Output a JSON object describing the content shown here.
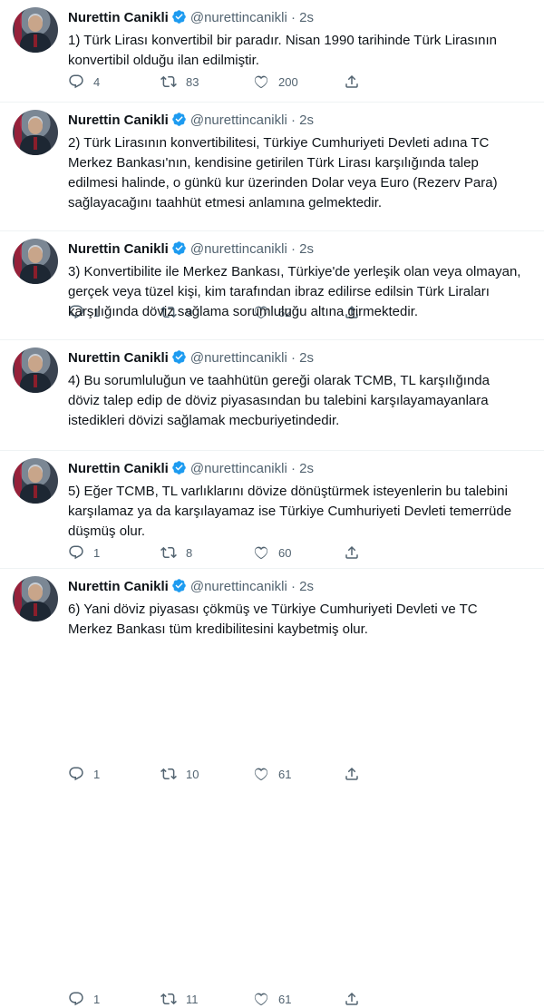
{
  "author": {
    "name": "Nurettin Canikli",
    "handle": "@nurettincanikli",
    "time": "2s",
    "dot": "·"
  },
  "tweets": [
    {
      "text": "1) Türk Lirası konvertibil bir paradır. Nisan 1990 tarihinde Türk Lirasının konvertibil olduğu ilan edilmiştir.",
      "replies": "4",
      "retweets": "83",
      "likes": "200"
    },
    {
      "text": "2) Türk Lirasının konvertibilitesi, Türkiye Cumhuriyeti Devleti adına TC Merkez Bankası'nın, kendisine getirilen Türk Lirası karşılığında talep edilmesi halinde, o günkü kur üzerinden Dolar veya Euro (Rezerv Para) sağlayacağını taahhüt etmesi anlamına gelmektedir.",
      "replies": "1",
      "retweets": "9",
      "likes": "62"
    },
    {
      "text": "3) Konvertibilite ile Merkez Bankası, Türkiye'de yerleşik olan veya olmayan, gerçek veya tüzel kişi, kim tarafından ibraz edilirse edilsin Türk Liraları karşılığında döviz sağlama sorumluluğu altına girmektedir.",
      "replies": "1",
      "retweets": "8",
      "likes": "60"
    },
    {
      "text": "4) Bu sorumluluğun ve taahhütün gereği olarak TCMB, TL karşılığında döviz talep edip de döviz piyasasından bu talebini karşılayamayanlara istedikleri dövizi sağlamak mecburiyetindedir.",
      "replies": "1",
      "retweets": "10",
      "likes": "61"
    },
    {
      "text": "5) Eğer TCMB, TL varlıklarını dövize dönüştürmek isteyenlerin bu talebini karşılamaz ya da karşılayamaz ise Türkiye Cumhuriyeti Devleti temerrüde düşmüş olur.",
      "replies": "1",
      "retweets": "11",
      "likes": "61"
    },
    {
      "text": "6) Yani döviz piyasası çökmüş ve Türkiye Cumhuriyeti Devleti ve TC Merkez Bankası tüm kredibilitesini kaybetmiş olur.",
      "replies": "",
      "retweets": "",
      "likes": ""
    }
  ],
  "icons": {
    "reply": "reply-icon",
    "retweet": "retweet-icon",
    "like": "heart-icon",
    "share": "share-icon",
    "verified": "verified-badge-icon"
  },
  "colors": {
    "verified": "#1d9bf0",
    "text": "#0f1419",
    "muted": "#536471"
  }
}
